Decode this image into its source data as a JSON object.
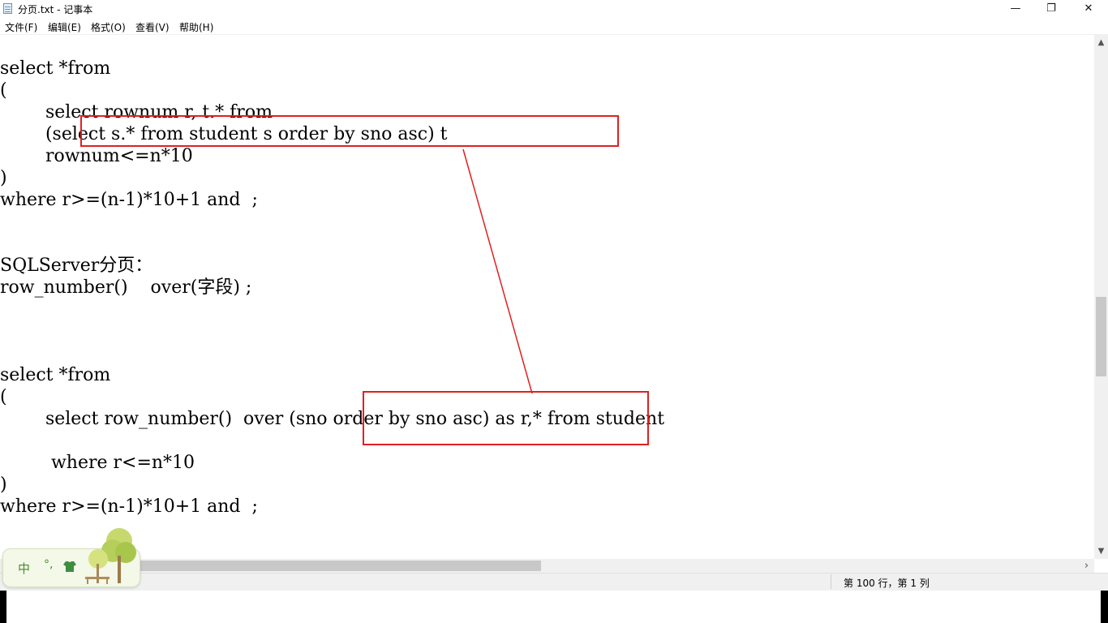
{
  "window": {
    "title": "分页.txt - 记事本",
    "buttons": {
      "minimize": "—",
      "maximize": "❐",
      "close": "✕"
    }
  },
  "menu": [
    "文件(F)",
    "编辑(E)",
    "格式(O)",
    "查看(V)",
    "帮助(H)"
  ],
  "editor": {
    "lines": [
      "select *from",
      "(",
      "        select rownum r, t.* from",
      "        (select s.* from student s order by sno asc) t",
      "        rownum<=n*10",
      ")",
      "where r>=(n-1)*10+1 and  ;",
      "SQLServer分页：",
      "row_number()    over(字段) ;",
      "select *from",
      "(",
      "        select row_number()  over (sno order by sno asc) as r,* from student",
      "         where r<=n*10",
      ")",
      "where r>=(n-1)*10+1 and  ;"
    ]
  },
  "annotation": {
    "color": "#e02020"
  },
  "status": {
    "position": "第 100 行，第 1 列"
  },
  "ime": {
    "mode": "中",
    "punct": "°,"
  },
  "scrollbars": {
    "up_arrow": "▲",
    "down_arrow": "▼",
    "right_arrow": "›"
  },
  "icons": [
    "notepad-icon",
    "shirt-icon",
    "tree-skin-icon"
  ]
}
